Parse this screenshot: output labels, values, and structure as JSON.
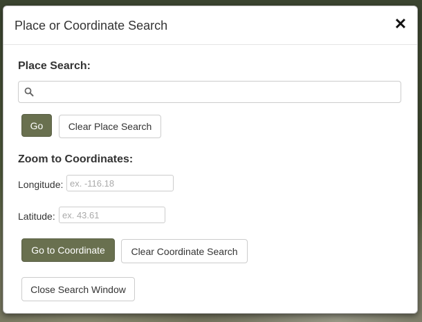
{
  "modal": {
    "title": "Place or Coordinate Search",
    "close_symbol": "✕"
  },
  "place_search": {
    "heading": "Place Search:",
    "input_value": "",
    "placeholder": "",
    "icon": "search-icon",
    "go_label": "Go",
    "clear_label": "Clear Place Search"
  },
  "coordinates": {
    "heading": "Zoom to Coordinates:",
    "longitude_label": "Longitude:",
    "longitude_placeholder": "ex. -116.18",
    "latitude_label": "Latitude:",
    "latitude_placeholder": "ex. 43.61",
    "go_label": "Go to Coordinate",
    "clear_label": "Clear Coordinate Search"
  },
  "close_window_label": "Close Search Window",
  "colors": {
    "primary_button": "#69704f"
  }
}
